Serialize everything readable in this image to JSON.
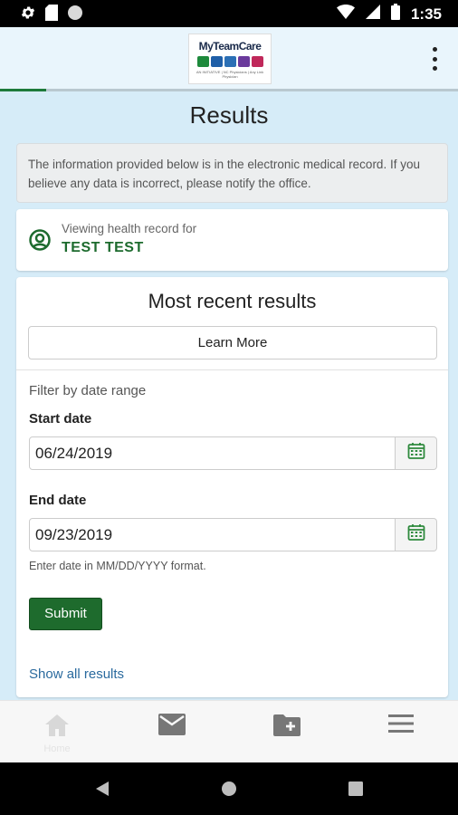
{
  "status_bar": {
    "time": "1:35"
  },
  "header": {
    "logo_text": "MyTeamCare",
    "logo_tagline": "AN INITIATIVE | NC Physicians | Any Link Physician"
  },
  "page": {
    "title": "Results"
  },
  "notice": {
    "text": "The information provided below is in the electronic medical record. If you believe any data is incorrect, please notify the office."
  },
  "viewing": {
    "label": "Viewing health record for",
    "patient_name": "TEST TEST"
  },
  "results_card": {
    "title": "Most recent results",
    "learn_more_label": "Learn More",
    "filter_label": "Filter by date range",
    "start_date_label": "Start date",
    "start_date_value": "06/24/2019",
    "end_date_label": "End date",
    "end_date_value": "09/23/2019",
    "date_hint": "Enter date in MM/DD/YYYY format.",
    "submit_label": "Submit",
    "show_all_label": "Show all results"
  },
  "bottom_nav": {
    "home_label": "Home"
  },
  "colors": {
    "accent_green": "#1e6b2d",
    "link_blue": "#2a6a9e",
    "background": "#d6ecf8"
  }
}
